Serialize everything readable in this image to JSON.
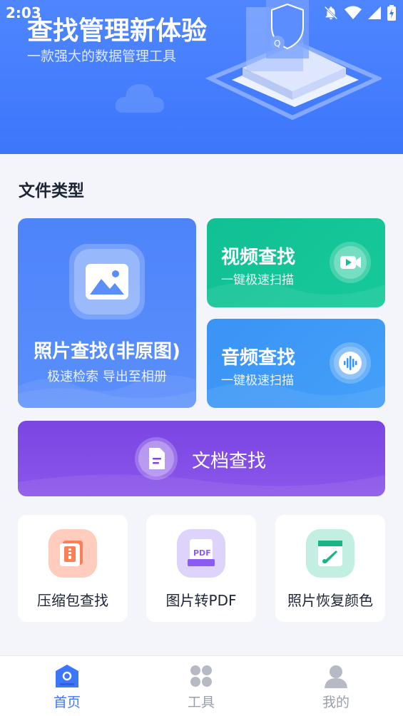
{
  "status_bar": {
    "time": "2:03"
  },
  "hero": {
    "title": "查找管理新体验",
    "subtitle": "一款强大的数据管理工具"
  },
  "section": {
    "title": "文件类型"
  },
  "cards": {
    "photo": {
      "title": "照片查找(非原图)",
      "subtitle": "极速检索 导出至相册"
    },
    "video": {
      "title": "视频查找",
      "subtitle": "一键极速扫描"
    },
    "audio": {
      "title": "音频查找",
      "subtitle": "一键极速扫描"
    },
    "document": {
      "title": "文档查找"
    }
  },
  "tools": [
    {
      "label": "压缩包查找",
      "icon": "zip-icon"
    },
    {
      "label": "图片转PDF",
      "icon": "pdf-icon"
    },
    {
      "label": "照片恢复颜色",
      "icon": "brush-icon"
    }
  ],
  "tabbar": {
    "items": [
      {
        "label": "首页",
        "icon": "home-icon",
        "active": true
      },
      {
        "label": "工具",
        "icon": "grid-icon",
        "active": false
      },
      {
        "label": "我的",
        "icon": "user-icon",
        "active": false
      }
    ]
  },
  "colors": {
    "hero_blue": "#3c76fb",
    "video_green": "#11c094",
    "audio_blue": "#3a93f6",
    "doc_purple": "#7a45e2",
    "tab_active": "#3c76fb",
    "tab_inactive": "#9aa0ab"
  }
}
